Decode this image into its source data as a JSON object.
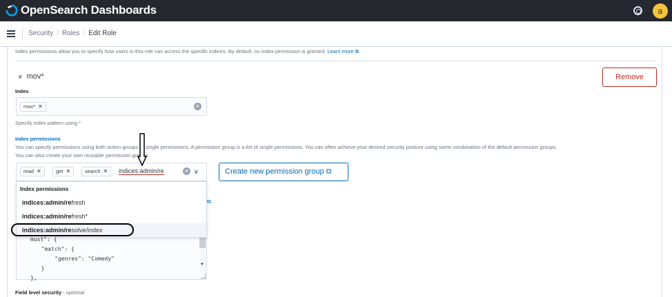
{
  "header": {
    "brand": "OpenSearch Dashboards",
    "avatar_letter": "a"
  },
  "breadcrumb": [
    "Security",
    "Roles",
    "Edit Role"
  ],
  "intro": {
    "text": "Index permissions allow you to specify how users in this role can access the specific indices. By default, no index permission is granted.",
    "link": "Learn more"
  },
  "section": {
    "title": "mov*",
    "remove_label": "Remove"
  },
  "index": {
    "label": "Index",
    "chips": [
      "mov*"
    ],
    "help": "Specify index pattern using *"
  },
  "index_permissions": {
    "label": "Index permissions",
    "help_line1": "You can specify permissions using both action groups or single permissions. A permission group is a list of single permissions. You can often achieve your desired security posture using some combination of the default permission groups.",
    "help_line2": "You can also create your own reusable permission groups.",
    "chips": [
      "read",
      "get",
      "search"
    ],
    "input_value": "indices:admin/re",
    "create_label": "Create new permission group"
  },
  "dropdown": {
    "heading": "Index permissions",
    "items": [
      {
        "match": "indices:admin/re",
        "rest": "fresh"
      },
      {
        "match": "indices:admin/re",
        "rest": "fresh*"
      },
      {
        "match": "indices:admin/re",
        "rest": "solve/index"
      }
    ]
  },
  "dls_code": [
    "must\": {",
    "  \"match\": {",
    "    \"genres\": \"Comedy\"",
    "  }",
    "},"
  ],
  "field_level": {
    "label": "Field level security",
    "optional": "optional"
  },
  "colors": {
    "topbar": "#25282f",
    "accent": "#006bb8",
    "danger": "#bd271e",
    "avatar": "#f5c33b"
  }
}
